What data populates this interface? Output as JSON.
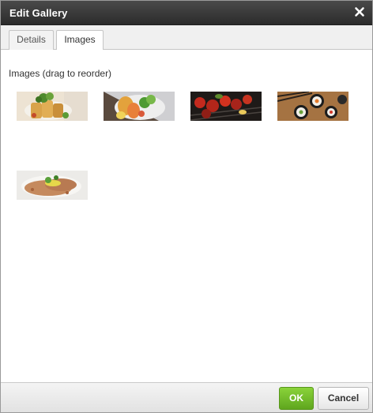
{
  "dialog": {
    "title": "Edit Gallery",
    "close_icon": "close-icon"
  },
  "tabs": [
    {
      "label": "Details",
      "active": false
    },
    {
      "label": "Images",
      "active": true
    }
  ],
  "images_panel": {
    "label": "Images (drag to reorder)",
    "thumbnails": [
      {
        "name": "thumb-spring-rolls"
      },
      {
        "name": "thumb-skewers-salad"
      },
      {
        "name": "thumb-grilled-tomato-kebabs"
      },
      {
        "name": "thumb-sushi-rolls"
      },
      {
        "name": "thumb-grilled-fish-lime"
      }
    ]
  },
  "footer": {
    "ok_label": "OK",
    "cancel_label": "Cancel"
  },
  "colors": {
    "titlebar": "#333333",
    "ok_green": "#6cb82a",
    "tab_border": "#c5c5c5"
  }
}
